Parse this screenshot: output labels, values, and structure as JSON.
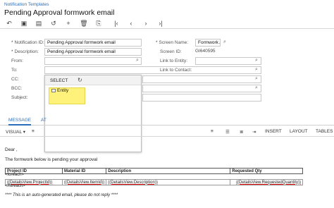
{
  "header": {
    "breadcrumb": "Notification Templates",
    "title": "Pending Approval formwork email"
  },
  "toolbar": {
    "icons": [
      "undo-icon",
      "save-icon",
      "save-close-icon",
      "cancel-icon",
      "add-icon",
      "delete-icon",
      "copy-icon",
      "first-icon",
      "prev-icon",
      "next-icon",
      "last-icon"
    ]
  },
  "form": {
    "notification_id_label": "Notification ID:",
    "notification_id_value": "Pending Approval formwork email",
    "description_label": "Description:",
    "description_value": "Pending Approval formwork email",
    "from_label": "From:",
    "to_label": "To:",
    "cc_label": "CC:",
    "bcc_label": "BCC:",
    "subject_label": "Subject:",
    "screen_name_label": "Screen Name:",
    "screen_name_value": "Formwork A",
    "screen_id_label": "Screen ID:",
    "screen_id_value": "GI640595",
    "link_entity_label": "Link to Entity:",
    "link_contact_label": "Link to Contact:",
    "required_mark": "*"
  },
  "dropdown": {
    "title": "SELECT",
    "item": "Entity"
  },
  "tabs": {
    "message": "MESSAGE",
    "attachments": "AT"
  },
  "editor_toolbar": {
    "visual": "VISUAL",
    "insert": "INSERT",
    "layout": "LAYOUT",
    "tables": "TABLES"
  },
  "body": {
    "greeting": "Dear ,",
    "intro": "The formwork below is pending your approval",
    "foreach_open": "<foreach>",
    "foreach_close": "</foreach>",
    "table_headers": [
      "Project ID",
      "Material ID",
      "Description",
      "Requested Qty"
    ],
    "table_row": [
      "((DetailsView.ProjectId))",
      "((DetailsView.ItemId))",
      "((DetailsView.Description))",
      "((DetailsView.RequestedQuantity))"
    ],
    "footer": "**** This is an auto-generated email, please do not reply ****"
  }
}
